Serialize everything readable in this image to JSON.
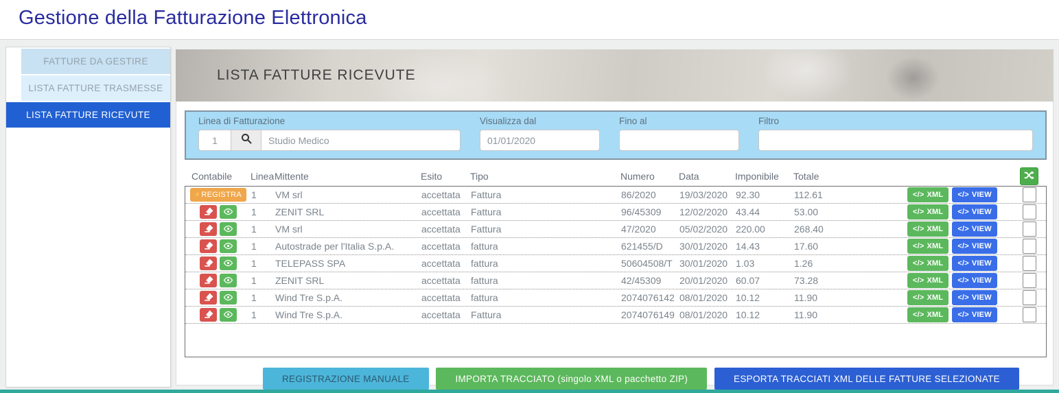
{
  "page": {
    "title": "Gestione della Fatturazione Elettronica"
  },
  "sidebar": {
    "items": [
      {
        "label": "FATTURE DA GESTIRE",
        "active": false
      },
      {
        "label": "LISTA FATTURE TRASMESSE",
        "active": false
      },
      {
        "label": "LISTA FATTURE RICEVUTE",
        "active": true
      }
    ]
  },
  "hero": {
    "title": "LISTA FATTURE RICEVUTE"
  },
  "filters": {
    "linea": {
      "label": "Linea di Fatturazione",
      "code_value": "1",
      "name_value": "Studio Medico"
    },
    "from": {
      "label": "Visualizza dal",
      "value": "01/01/2020"
    },
    "to": {
      "label": "Fino al",
      "value": ""
    },
    "filtro": {
      "label": "Filtro",
      "value": ""
    }
  },
  "table": {
    "columns": [
      "Contabile",
      "Linea",
      "Mittente",
      "Esito",
      "Tipo",
      "Numero",
      "Data",
      "Imponibile",
      "Totale"
    ],
    "actions": {
      "registra_label": "REGISTRA",
      "bolt_glyph": "⚡",
      "code_glyph": "</>",
      "xml_label": "XML",
      "view_label": "VIEW"
    },
    "rows": [
      {
        "contabile": "registra",
        "linea": "1",
        "mittente": "VM srl",
        "esito": "accettata",
        "tipo": "Fattura",
        "numero": "86/2020",
        "data": "19/03/2020",
        "imponibile": "92.30",
        "totale": "112.61"
      },
      {
        "contabile": "edit",
        "linea": "1",
        "mittente": "ZENIT SRL",
        "esito": "accettata",
        "tipo": "Fattura",
        "numero": "96/45309",
        "data": "12/02/2020",
        "imponibile": "43.44",
        "totale": "53.00"
      },
      {
        "contabile": "edit",
        "linea": "1",
        "mittente": "VM srl",
        "esito": "accettata",
        "tipo": "Fattura",
        "numero": "47/2020",
        "data": "05/02/2020",
        "imponibile": "220.00",
        "totale": "268.40"
      },
      {
        "contabile": "edit",
        "linea": "1",
        "mittente": "Autostrade per l'Italia S.p.A.",
        "esito": "accettata",
        "tipo": "fattura",
        "numero": "621455/D",
        "data": "30/01/2020",
        "imponibile": "14.43",
        "totale": "17.60"
      },
      {
        "contabile": "edit",
        "linea": "1",
        "mittente": "TELEPASS SPA",
        "esito": "accettata",
        "tipo": "fattura",
        "numero": "50604508/T",
        "data": "30/01/2020",
        "imponibile": "1.03",
        "totale": "1.26"
      },
      {
        "contabile": "edit",
        "linea": "1",
        "mittente": "ZENIT SRL",
        "esito": "accettata",
        "tipo": "fattura",
        "numero": "42/45309",
        "data": "20/01/2020",
        "imponibile": "60.07",
        "totale": "73.28"
      },
      {
        "contabile": "edit",
        "linea": "1",
        "mittente": "Wind Tre S.p.A.",
        "esito": "accettata",
        "tipo": "fattura",
        "numero": "2074076142",
        "data": "08/01/2020",
        "imponibile": "10.12",
        "totale": "11.90"
      },
      {
        "contabile": "edit",
        "linea": "1",
        "mittente": "Wind Tre S.p.A.",
        "esito": "accettata",
        "tipo": "Fattura",
        "numero": "2074076149",
        "data": "08/01/2020",
        "imponibile": "10.12",
        "totale": "11.90"
      }
    ]
  },
  "footer": {
    "manual_label": "REGISTRAZIONE MANUALE",
    "import_label": "IMPORTA TRACCIATO (singolo XML o pacchetto ZIP)",
    "export_label": "ESPORTA TRACCIATI XML DELLE FATTURE SELEZIONATE"
  },
  "colors": {
    "title_text": "#2a2b9f",
    "active_nav_bg": "#2160d2",
    "filter_bar_bg": "#a8dbf5",
    "registra_bg": "#f0a64a",
    "delete_bg": "#d9534f",
    "eye_bg": "#5cb85c",
    "xml_bg": "#5cb85c",
    "view_bg": "#3a6ee8",
    "shuffle_bg": "#4cae4c",
    "manual_btn_bg": "#4cb5da",
    "import_btn_bg": "#5cb85c",
    "export_btn_bg": "#2c5fd3",
    "bottom_bar": "#2fa89e"
  }
}
